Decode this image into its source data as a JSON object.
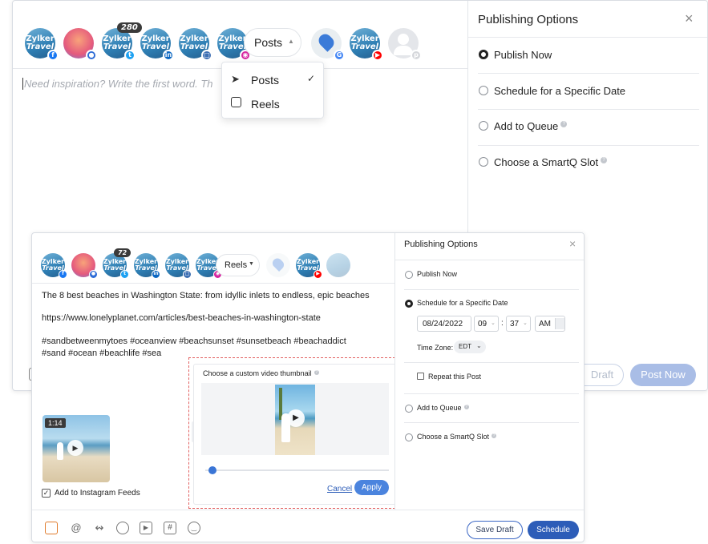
{
  "back": {
    "accounts": [
      {
        "line1": "Zylker",
        "line2": "Travel",
        "network": "facebook",
        "color": "#1877f2",
        "glyph": "f"
      },
      {
        "line1": "",
        "line2": "",
        "network": "group",
        "color": "#2c6bd6",
        "glyph": "g"
      },
      {
        "line1": "Zylker",
        "line2": "Travel",
        "network": "twitter",
        "color": "#1da1f2",
        "glyph": "t",
        "count": "280"
      },
      {
        "line1": "Zylker",
        "line2": "Travel",
        "network": "linkedin",
        "color": "#0a66c2",
        "glyph": "in"
      },
      {
        "line1": "Zylker",
        "line2": "Travel",
        "network": "page",
        "color": "#3d6fb3",
        "glyph": "p"
      },
      {
        "line1": "Zylker",
        "line2": "Travel",
        "network": "instagram",
        "color": "#d6249f",
        "glyph": "ig"
      },
      {
        "line1": "",
        "line2": "",
        "network": "google",
        "color": "#4285f4",
        "glyph": "G"
      },
      {
        "line1": "Zylker",
        "line2": "Travel",
        "network": "youtube",
        "color": "#ff0000",
        "glyph": "yt"
      },
      {
        "line1": "",
        "line2": "",
        "network": "pinterest",
        "color": "#d5d7db",
        "glyph": "p"
      }
    ],
    "post_type": "Posts",
    "placeholder": "Need inspiration? Write the first word. Th",
    "menu": [
      {
        "icon": "send-icon",
        "label": "Posts",
        "checked": true
      },
      {
        "icon": "reels-icon",
        "label": "Reels",
        "checked": false
      }
    ],
    "panel_title": "Publishing Options",
    "options": [
      {
        "label": "Publish Now",
        "selected": true,
        "help": false
      },
      {
        "label": "Schedule for a Specific Date",
        "selected": false,
        "help": false
      },
      {
        "label": "Add to Queue",
        "selected": false,
        "help": true
      },
      {
        "label": "Choose a SmartQ Slot",
        "selected": false,
        "help": true
      }
    ],
    "draft_label": "Draft",
    "post_now_label": "Post Now"
  },
  "front": {
    "count": "72",
    "post_type": "Reels",
    "text_lines": [
      "The 8 best beaches in Washington State: from idyllic inlets to endless, epic beaches",
      "https://www.lonelyplanet.com/articles/best-beaches-in-washington-state",
      "#sandbetweenmytoes #oceanview #beachsunset #sunsetbeach #beachaddict",
      "#sand #ocean #beachlife #sea"
    ],
    "video_duration": "1:14",
    "add_to_feeds_label": "Add to Instagram Feeds",
    "add_to_feeds_checked": true,
    "thumb_title": "Choose a custom video thumbnail",
    "thumb_progress": 0.02,
    "cancel_label": "Cancel",
    "apply_label": "Apply",
    "panel_title": "Publishing Options",
    "options": {
      "publish_now": "Publish Now",
      "schedule": "Schedule for a Specific Date",
      "queue": "Add to Queue",
      "smartq": "Choose a SmartQ Slot"
    },
    "date": "08/24/2022",
    "hour": "09",
    "minute": "37",
    "ampm": "AM",
    "timezone_label": "Time Zone:",
    "timezone": "EDT",
    "repeat_label": "Repeat this Post",
    "save_draft_label": "Save Draft",
    "schedule_label": "Schedule",
    "toolbar_icons": [
      "image-icon",
      "mention-icon",
      "link-shortener-icon",
      "tag-icon",
      "video-icon",
      "hashtag-icon",
      "emoji-icon"
    ]
  }
}
